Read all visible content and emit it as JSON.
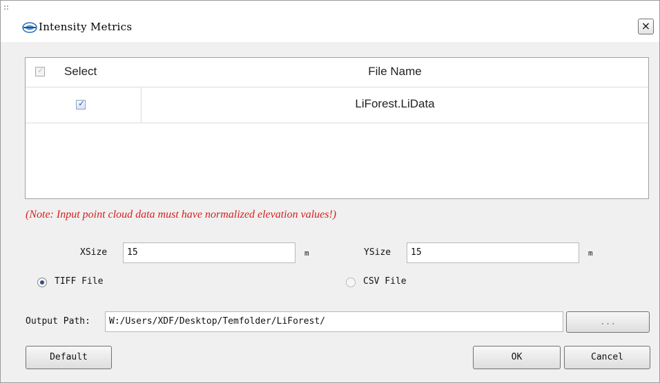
{
  "window": {
    "title": "Intensity Metrics",
    "close_glyph": "×",
    "logo": "app-logo-icon"
  },
  "table": {
    "columns": [
      "Select",
      "File Name"
    ],
    "rows": [
      {
        "selected": true,
        "file_name": "LiForest.LiData"
      }
    ]
  },
  "note": "(Note: Input point cloud data must have normalized elevation values!)",
  "size": {
    "x_label": "XSize",
    "x_value": "15",
    "x_unit": "m",
    "y_label": "YSize",
    "y_value": "15",
    "y_unit": "m"
  },
  "output_format": {
    "options": [
      "TIFF File",
      "CSV File"
    ],
    "selected": "TIFF File"
  },
  "output_path": {
    "label": "Output Path:",
    "value": "W:/Users/XDF/Desktop/Temfolder/LiForest/",
    "browse_label": "..."
  },
  "buttons": {
    "default": "Default",
    "ok": "OK",
    "cancel": "Cancel"
  },
  "colors": {
    "note": "#d42020",
    "radio_selected": "#2f4f88",
    "dialog_bg": "#f0f0f0"
  }
}
